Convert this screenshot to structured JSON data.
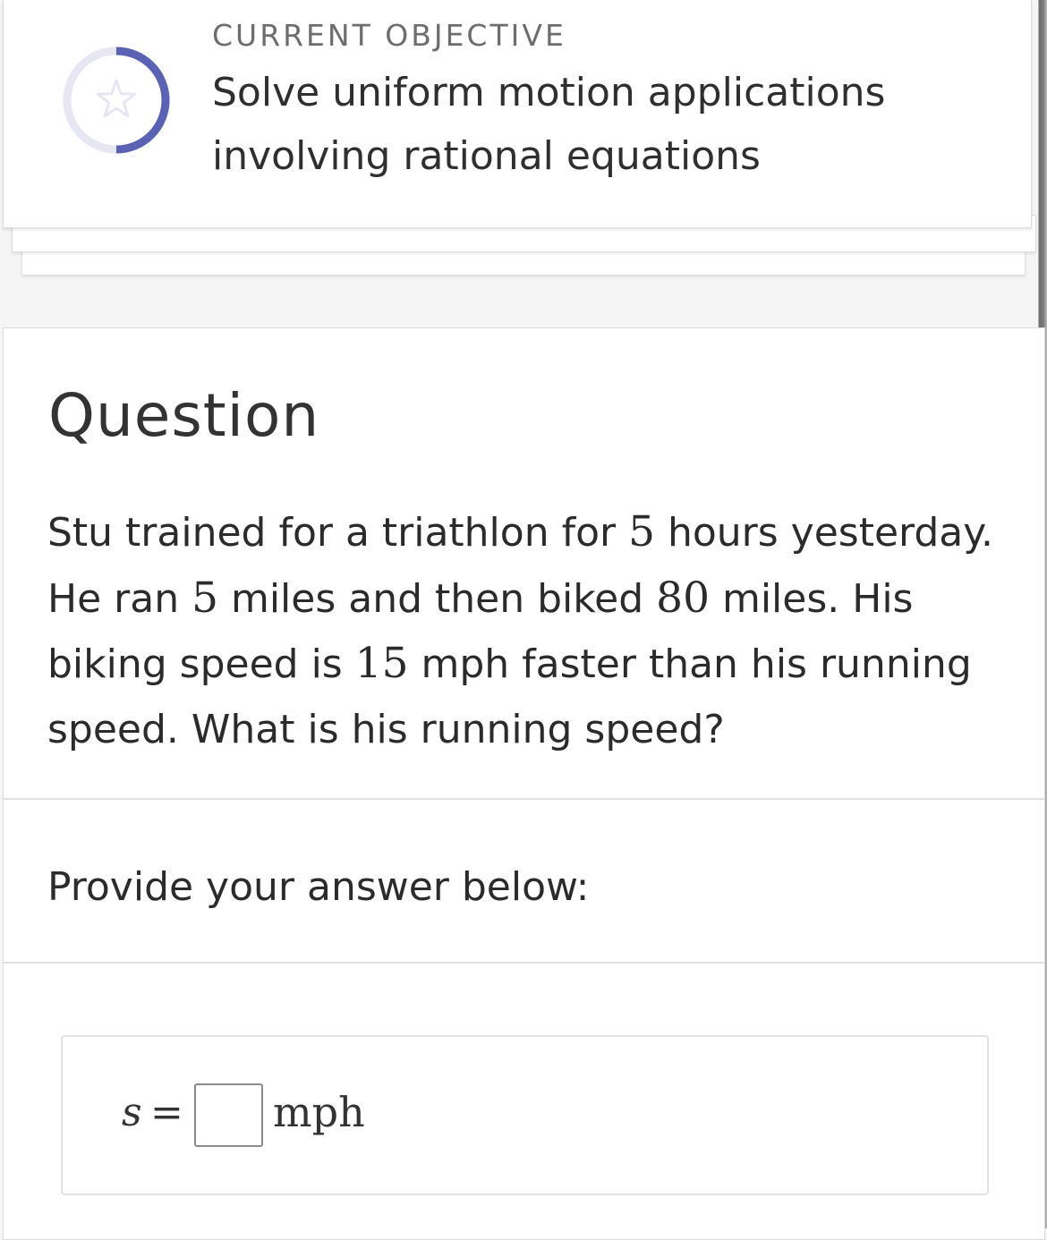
{
  "objective": {
    "label": "CURRENT OBJECTIVE",
    "title": "Solve uniform motion applications involving rational equations",
    "progress_fraction": 0.5,
    "ring_color": "#5b62b5",
    "ring_track_color": "#e6e7f3",
    "icon": "star-icon"
  },
  "question": {
    "heading": "Question",
    "text_parts": [
      "Stu trained for a triathlon for ",
      "5",
      " hours yesterday. He ran ",
      "5",
      " miles and then biked ",
      "80",
      " miles. His biking speed is ",
      "15",
      " mph faster than his running speed. What is his running speed?"
    ]
  },
  "answer": {
    "prompt": "Provide your answer below:",
    "variable": "s",
    "equals": "=",
    "input_value": "",
    "unit": "mph"
  }
}
